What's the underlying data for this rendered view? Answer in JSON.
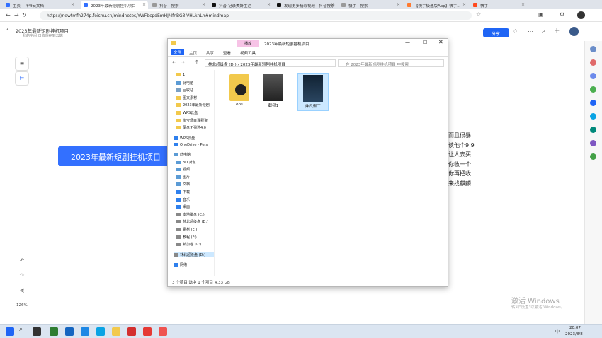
{
  "browser": {
    "tabs": [
      {
        "label": "主页 - 飞书云文档",
        "color": "#3370ff"
      },
      {
        "label": "2023年最新短剧挂机项目",
        "color": "#3370ff"
      },
      {
        "label": "抖音 - 搜索",
        "color": "#999999"
      },
      {
        "label": "抖音-记录美好生活",
        "color": "#111111"
      },
      {
        "label": "发现更多精彩视频 - 抖音搜索",
        "color": "#111111"
      },
      {
        "label": "快手 - 搜索",
        "color": "#999999"
      },
      {
        "label": "【快手极速版App】快手...",
        "color": "#ff7a2f"
      },
      {
        "label": "快手",
        "color": "#ff4a1f"
      }
    ],
    "url": "https://newtmfh274p.feishu.cn/mindnotes/YWFbcpdEmHJMfnBG3lVHLknLh#mindmap"
  },
  "doc": {
    "title": "2023年最新短剧挂机项目",
    "subtitle": "我的空间   日收保存到云端",
    "share_label": "分享",
    "node_text": "2023年最新短剧挂机项目",
    "content_lines": [
      "而且很暴",
      "读他个9.9",
      "让人去买",
      "你收一个",
      "你再把收",
      "来找麒麟"
    ],
    "zoom": "126%"
  },
  "explorer": {
    "title": "2023年最新短剧挂机项目",
    "context_tab": "播放",
    "ribbon_tabs": [
      "文件",
      "主页",
      "共享",
      "查看",
      "视频工具"
    ],
    "path": [
      "林北超级盘 (D:)",
      "2023年最新短剧挂机项目"
    ],
    "search_placeholder": "在 2023年最新短剧挂机项目 中搜索",
    "nav_items": [
      {
        "label": "1",
        "color": "#f2c94c"
      },
      {
        "label": "此电脑",
        "color": "#5b9bd5"
      },
      {
        "label": "回收站",
        "color": "#7aa0c4"
      },
      {
        "label": "图文素材",
        "color": "#f2c94c"
      },
      {
        "label": "2023年最新短剧",
        "color": "#f2c94c"
      },
      {
        "label": "WPS云盘",
        "color": "#f2c94c"
      },
      {
        "label": "淘宝项目课程资",
        "color": "#f2c94c"
      },
      {
        "label": "尾盘无强选4.0",
        "color": "#f2c94c"
      },
      {
        "label": "WPS云盘",
        "color": "#2f80ed"
      },
      {
        "label": "OneDrive - Pers",
        "color": "#2f80ed"
      },
      {
        "label": "此电脑",
        "color": "#5b9bd5"
      },
      {
        "label": "3D 对象",
        "color": "#5b9bd5"
      },
      {
        "label": "视频",
        "color": "#5b9bd5"
      },
      {
        "label": "图片",
        "color": "#5b9bd5"
      },
      {
        "label": "文档",
        "color": "#5b9bd5"
      },
      {
        "label": "下载",
        "color": "#2f80ed"
      },
      {
        "label": "音乐",
        "color": "#2f80ed"
      },
      {
        "label": "桌面",
        "color": "#2f80ed"
      },
      {
        "label": "本地磁盘 (C:)",
        "color": "#888888"
      },
      {
        "label": "林北超级盘 (D:)",
        "color": "#888888"
      },
      {
        "label": "素材 (E:)",
        "color": "#888888"
      },
      {
        "label": "教程 (F:)",
        "color": "#888888"
      },
      {
        "label": "新加卷 (G:)",
        "color": "#888888"
      },
      {
        "label": "林北超级盘 (D:)",
        "color": "#888888"
      },
      {
        "label": "网络",
        "color": "#2f80ed"
      }
    ],
    "files": [
      {
        "name": "obs",
        "type": "folder"
      },
      {
        "name": "截频1",
        "type": "video"
      },
      {
        "name": "妹凡御工",
        "type": "video",
        "selected": true
      }
    ],
    "status": "3 个项目   选中 1 个项目  4.33 GB"
  },
  "system": {
    "time": "20:07",
    "date": "2023/8/8",
    "ime": "中",
    "watermark": "激活 Windows",
    "watermark_sub": "转到\"设置\"以激活 Windows。"
  }
}
